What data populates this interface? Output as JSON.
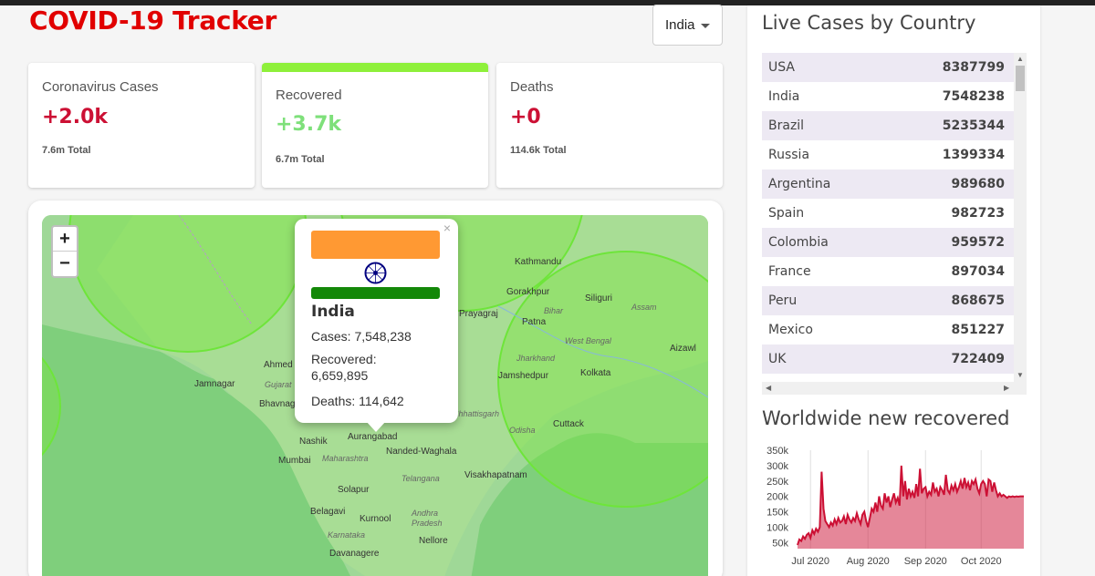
{
  "app": {
    "title": "COVID-19 Tracker"
  },
  "country_select": {
    "value": "India"
  },
  "stats": {
    "cases": {
      "label": "Coronavirus Cases",
      "today": "+2.0k",
      "total": "7.6m Total"
    },
    "recovered": {
      "label": "Recovered",
      "today": "+3.7k",
      "total": "6.7m Total"
    },
    "deaths": {
      "label": "Deaths",
      "today": "+0",
      "total": "114.6k Total"
    }
  },
  "colors": {
    "cases": "#cc1034",
    "recovered": "#7dd71d",
    "deaths": "#cc1034",
    "title": "#e10000"
  },
  "map": {
    "zoom_in": "+",
    "zoom_out": "−",
    "popup": {
      "close": "×",
      "country": "India",
      "cases": "Cases: 7,548,238",
      "recovered_label": "Recovered:",
      "recovered_value": "6,659,895",
      "deaths": "Deaths: 114,642"
    },
    "place_labels": [
      "Ahmed",
      "Jamnagar",
      "Bhavnag",
      "Nashik",
      "Aurangabad",
      "Nanded-Waghala",
      "Mumbai",
      "Maharashtra",
      "Telangana",
      "Visakhapatnam",
      "Solapur",
      "Belagavi",
      "Kurnool",
      "Andhra Pradesh",
      "Karnataka",
      "Nellore",
      "Davanagere",
      "Jamshedpur",
      "Kolkata",
      "Patna",
      "Siliguri",
      "Cuttack",
      "Odisha",
      "Kathmandu",
      "Gorakhpur",
      "Aizawl",
      "Assam",
      "Bihar",
      "Jharkhand",
      "West Bengal",
      "Gujarat",
      "Prayagraj",
      "Chhattisgarh"
    ]
  },
  "live_cases": {
    "title": "Live Cases by Country",
    "rows": [
      {
        "country": "USA",
        "cases": "8387799"
      },
      {
        "country": "India",
        "cases": "7548238"
      },
      {
        "country": "Brazil",
        "cases": "5235344"
      },
      {
        "country": "Russia",
        "cases": "1399334"
      },
      {
        "country": "Argentina",
        "cases": "989680"
      },
      {
        "country": "Spain",
        "cases": "982723"
      },
      {
        "country": "Colombia",
        "cases": "959572"
      },
      {
        "country": "France",
        "cases": "897034"
      },
      {
        "country": "Peru",
        "cases": "868675"
      },
      {
        "country": "Mexico",
        "cases": "851227"
      },
      {
        "country": "UK",
        "cases": "722409"
      }
    ]
  },
  "chart_data": {
    "type": "area",
    "title": "Worldwide new recovered",
    "xlabel": "",
    "ylabel": "",
    "ylim": [
      30000,
      350000
    ],
    "yticks": [
      "350k",
      "300k",
      "250k",
      "200k",
      "150k",
      "100k",
      "50k"
    ],
    "ytick_values": [
      350000,
      300000,
      250000,
      200000,
      150000,
      100000,
      50000
    ],
    "xticks": [
      "Jul 2020",
      "Aug 2020",
      "Sep 2020",
      "Oct 2020"
    ],
    "xtick_days": [
      7,
      38,
      69,
      99
    ],
    "x_start_date": "2020-06-24",
    "x_end_date": "2020-10-26",
    "line_color": "#cc1034",
    "fill_color": "rgba(204,16,52,0.5)",
    "values": [
      42000,
      60000,
      55000,
      70000,
      62000,
      75000,
      80000,
      65000,
      90000,
      78000,
      95000,
      85000,
      100000,
      280000,
      160000,
      120000,
      110000,
      100000,
      115000,
      105000,
      125000,
      110000,
      130000,
      115000,
      120000,
      135000,
      110000,
      140000,
      125000,
      115000,
      130000,
      120000,
      145000,
      125000,
      110000,
      140000,
      150000,
      120000,
      100000,
      130000,
      160000,
      150000,
      180000,
      150000,
      200000,
      170000,
      160000,
      210000,
      180000,
      200000,
      165000,
      190000,
      210000,
      180000,
      195000,
      170000,
      300000,
      200000,
      250000,
      190000,
      225000,
      200000,
      215000,
      195000,
      240000,
      200000,
      290000,
      210000,
      225000,
      230000,
      200000,
      215000,
      205000,
      245000,
      215000,
      225000,
      200000,
      230000,
      220000,
      205000,
      270000,
      220000,
      210000,
      235000,
      220000,
      240000,
      215000,
      230000,
      250000,
      225000,
      260000,
      230000,
      245000,
      220000,
      250000,
      240000,
      255000,
      225000,
      210000,
      240000,
      250000,
      240000,
      200000,
      255000,
      250000,
      215000,
      245000,
      220000,
      200000,
      210000,
      200000,
      205000,
      200000,
      195000,
      200000,
      198000,
      200000,
      198000,
      200000,
      199000,
      200000,
      200000,
      200000
    ]
  }
}
